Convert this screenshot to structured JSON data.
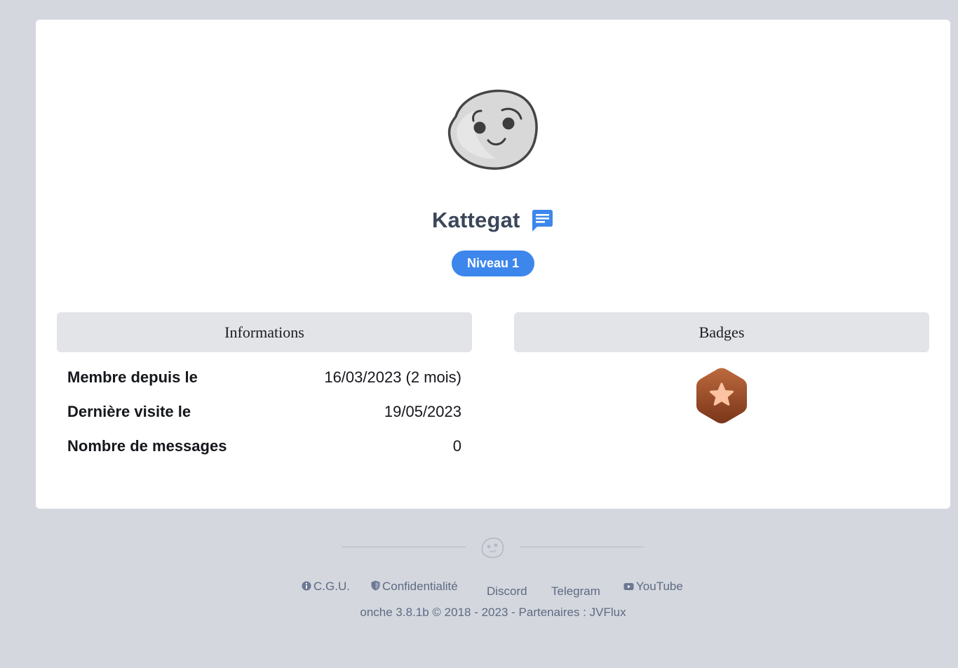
{
  "profile": {
    "username": "Kattegat",
    "level": "Niveau 1",
    "avatar_icon": "smiley-avatar-icon",
    "message_icon": "chat-message-icon"
  },
  "informations": {
    "title": "Informations",
    "rows": [
      {
        "label": "Membre depuis le",
        "value": "16/03/2023 (2 mois)"
      },
      {
        "label": "Dernière visite le",
        "value": "19/05/2023"
      },
      {
        "label": "Nombre de messages",
        "value": "0"
      }
    ]
  },
  "badges": {
    "title": "Badges",
    "items": [
      {
        "icon": "bronze-star-badge-icon",
        "color": "#a0502b"
      }
    ]
  },
  "footer": {
    "links": {
      "cgu": "C.G.U.",
      "confidentialite": "Confidentialité",
      "discord": "Discord",
      "telegram": "Telegram",
      "youtube": "YouTube"
    },
    "copyright_prefix": "onche 3.8.1b © 2018 - 2023 - Partenaires : ",
    "partner": "JVFlux"
  },
  "colors": {
    "background": "#d4d7de",
    "card": "#ffffff",
    "accent": "#3d87ec",
    "panel_header": "#e3e4e8",
    "footer_text": "#5e6b82"
  }
}
